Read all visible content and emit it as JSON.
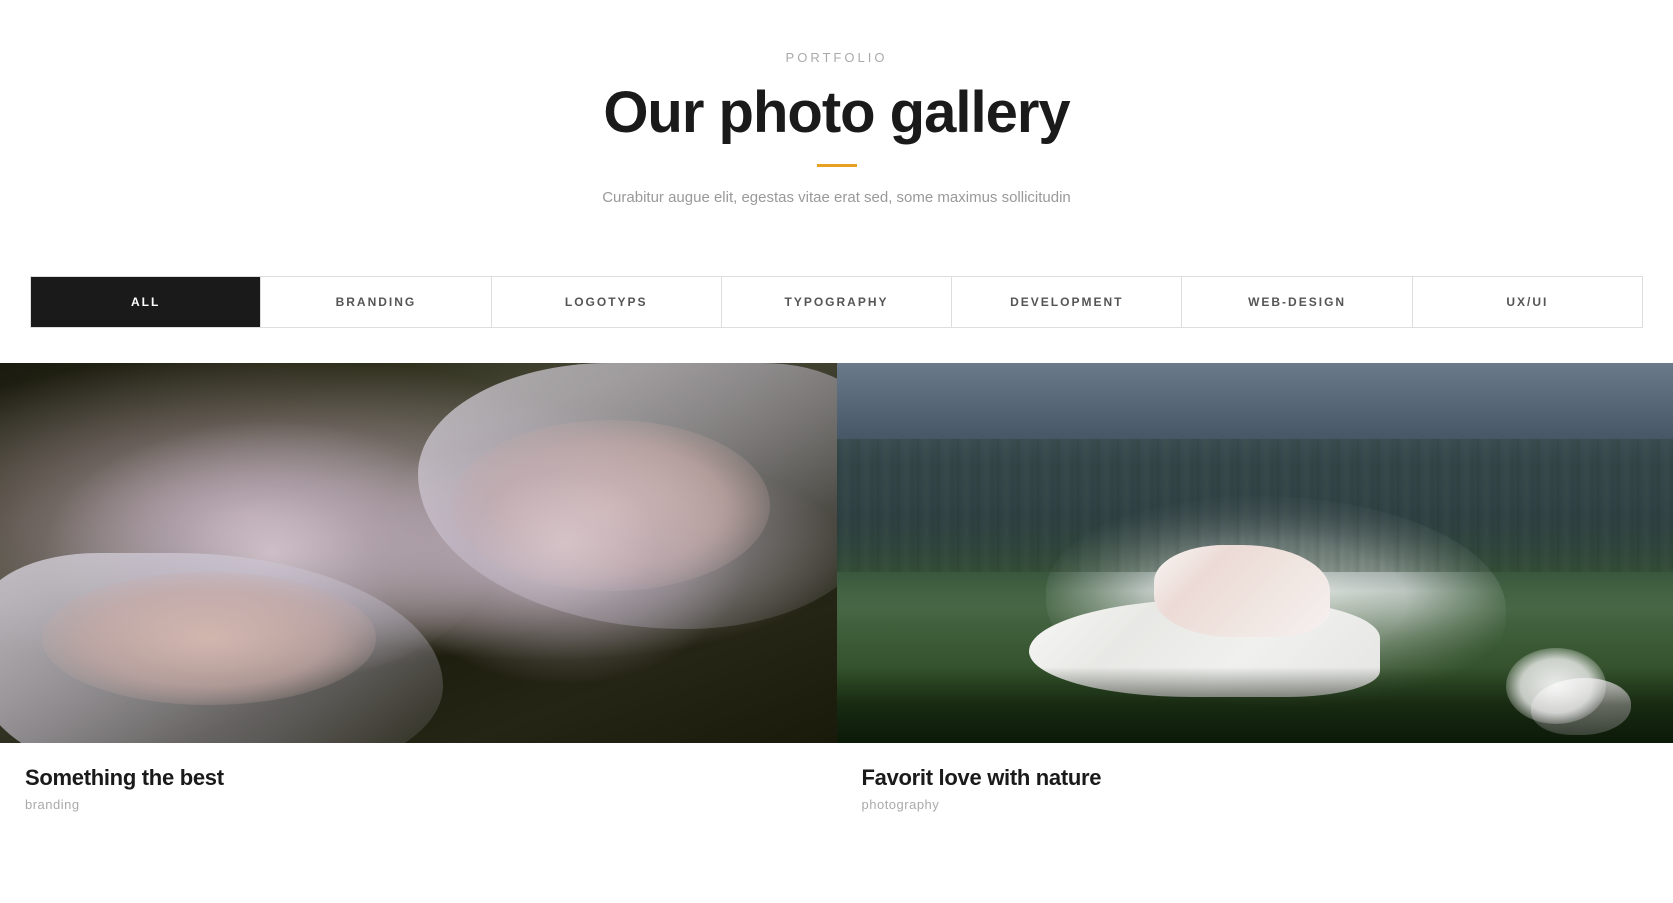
{
  "header": {
    "portfolio_label": "PORTFOLIO",
    "main_title": "Our photo gallery",
    "subtitle": "Curabitur augue elit, egestas vitae erat sed, some maximus sollicitudin",
    "accent_color": "#e8a020"
  },
  "filter_tabs": {
    "tabs": [
      {
        "id": "all",
        "label": "ALL",
        "active": true
      },
      {
        "id": "branding",
        "label": "BRANDING",
        "active": false
      },
      {
        "id": "logotyps",
        "label": "LOGOTYPS",
        "active": false
      },
      {
        "id": "typography",
        "label": "TYPOGRAPHY",
        "active": false
      },
      {
        "id": "development",
        "label": "DEVELOPMENT",
        "active": false
      },
      {
        "id": "web-design",
        "label": "WEB-DESIGN",
        "active": false
      },
      {
        "id": "ux-ui",
        "label": "UX/UI",
        "active": false
      }
    ]
  },
  "gallery": {
    "items": [
      {
        "id": 1,
        "title": "Something the best",
        "category": "branding",
        "alt": "Two women with white hair lying down in nature"
      },
      {
        "id": 2,
        "title": "Favorit love with nature",
        "category": "photography",
        "alt": "Woman in white dress lying on grass with a rabbit"
      }
    ]
  }
}
